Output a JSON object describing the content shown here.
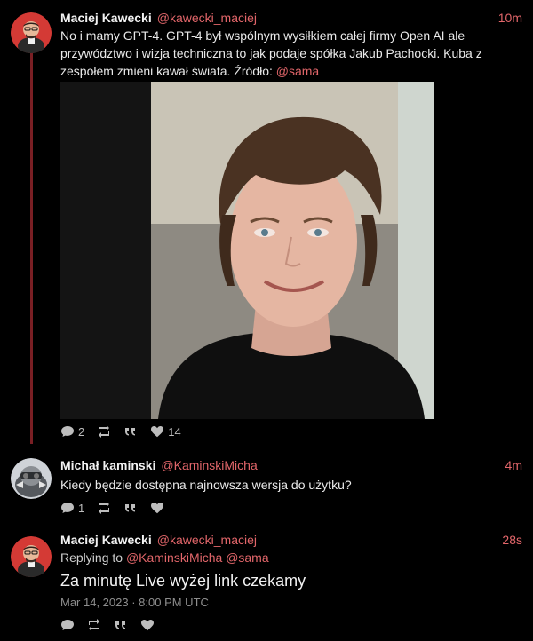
{
  "posts": [
    {
      "author": "Maciej Kawecki",
      "handle": "@kawecki_maciej",
      "time": "10m",
      "text_line1": "No i mamy GPT-4. GPT-4 był wspólnym wysiłkiem całej firmy Open AI ale",
      "text_line2": "przywództwo i wizja techniczna to jak podaje spółka Jakub Pachocki. Kuba z",
      "text_line3_prefix": "zespołem zmieni kawał świata. Źródło: ",
      "text_line3_mention": "@sama",
      "actions": {
        "replies": "2",
        "reposts": "",
        "quotes": "",
        "likes": "14"
      }
    },
    {
      "author": "Michał kaminski",
      "handle": "@KaminskiMicha",
      "time": "4m",
      "text": "Kiedy będzie dostępna najnowsza wersja do użytku?",
      "actions": {
        "replies": "1",
        "reposts": "",
        "quotes": "",
        "likes": ""
      }
    },
    {
      "author": "Maciej Kawecki",
      "handle": "@kawecki_maciej",
      "time": "28s",
      "replying_label": "Replying to",
      "replying_mention1": "@KaminskiMicha",
      "replying_mention2": "@sama",
      "text": "Za minutę Live wyżej link czekamy",
      "timestamp": "Mar 14, 2023 · 8:00 PM UTC",
      "actions": {
        "replies": "",
        "reposts": "",
        "quotes": "",
        "likes": ""
      }
    }
  ],
  "colors": {
    "accent": "#e2666a",
    "thread_line": "#7a1f24",
    "background": "#000000"
  },
  "icons": [
    "comment-icon",
    "repost-icon",
    "quote-icon",
    "heart-icon"
  ]
}
